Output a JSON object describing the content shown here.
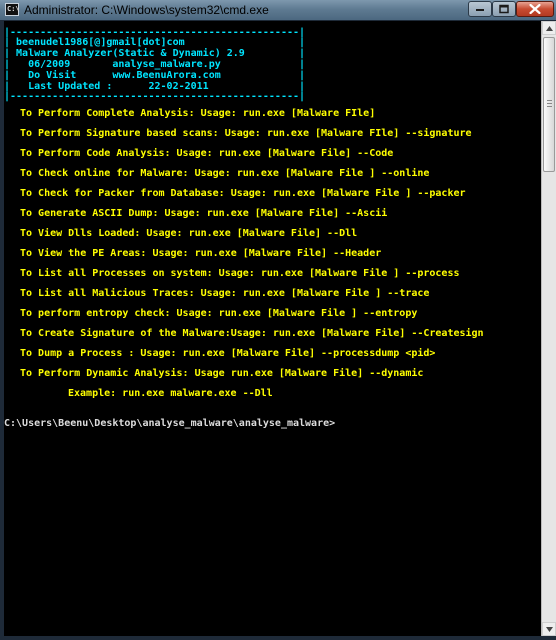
{
  "window": {
    "title": "Administrator: C:\\Windows\\system32\\cmd.exe",
    "sys_icon_text": "C:\\"
  },
  "banner": [
    "|------------------------------------------------|",
    "| beenudel1986[@]gmail[dot]com                   |",
    "| Malware Analyzer(Static & Dynamic) 2.9         |",
    "|   06/2009       analyse_malware.py             |",
    "|   Do Visit      www.BeenuArora.com             |",
    "|   Last Updated :      22-02-2011               |",
    "|------------------------------------------------|"
  ],
  "usage_lines": [
    "To Perform Complete Analysis: Usage: run.exe [Malware FIle]",
    "To Perform Signature based scans: Usage: run.exe [Malware FIle] --signature",
    "To Perform Code Analysis: Usage: run.exe [Malware File] --Code",
    "To Check online for Malware: Usage: run.exe [Malware File ] --online",
    "To Check for Packer from Database: Usage: run.exe [Malware File ] --packer",
    "To Generate ASCII Dump: Usage: run.exe [Malware File] --Ascii",
    "To View Dlls Loaded: Usage: run.exe [Malware File] --Dll",
    "To View the PE Areas: Usage: run.exe [Malware File] --Header",
    "To List all Processes on system: Usage: run.exe [Malware File ] --process",
    "To List all Malicious Traces: Usage: run.exe [Malware File ] --trace",
    "To perform entropy check: Usage: run.exe [Malware File ] --entropy",
    "To Create Signature of the Malware:Usage: run.exe [Malware File] --Createsign",
    "To Dump a Process : Usage: run.exe [Malware File] --processdump <pid>",
    "To Perform Dynamic Analysis: Usage run.exe [Malware File] --dynamic"
  ],
  "example_line": "Example: run.exe malware.exe --Dll",
  "prompt": "C:\\Users\\Beenu\\Desktop\\analyse_malware\\analyse_malware>",
  "colors": {
    "banner": "#00e5ff",
    "usage": "#ffff00",
    "prompt": "#dcdcdc",
    "console_bg": "#000000"
  },
  "icons": {
    "minimize": "minimize-icon",
    "maximize": "maximize-icon",
    "close": "close-icon",
    "scroll_up": "scroll-up-arrow-icon",
    "scroll_down": "scroll-down-arrow-icon"
  }
}
